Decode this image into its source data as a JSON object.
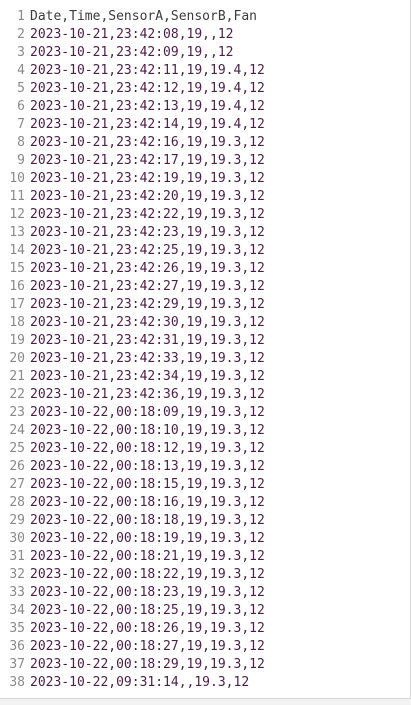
{
  "editor": {
    "lines": [
      {
        "num": "1",
        "text": "Date,Time,SensorA,SensorB,Fan"
      },
      {
        "num": "2",
        "text": "2023-10-21,23:42:08,19,,12"
      },
      {
        "num": "3",
        "text": "2023-10-21,23:42:09,19,,12"
      },
      {
        "num": "4",
        "text": "2023-10-21,23:42:11,19,19.4,12"
      },
      {
        "num": "5",
        "text": "2023-10-21,23:42:12,19,19.4,12"
      },
      {
        "num": "6",
        "text": "2023-10-21,23:42:13,19,19.4,12"
      },
      {
        "num": "7",
        "text": "2023-10-21,23:42:14,19,19.4,12"
      },
      {
        "num": "8",
        "text": "2023-10-21,23:42:16,19,19.3,12"
      },
      {
        "num": "9",
        "text": "2023-10-21,23:42:17,19,19.3,12"
      },
      {
        "num": "10",
        "text": "2023-10-21,23:42:19,19,19.3,12"
      },
      {
        "num": "11",
        "text": "2023-10-21,23:42:20,19,19.3,12"
      },
      {
        "num": "12",
        "text": "2023-10-21,23:42:22,19,19.3,12"
      },
      {
        "num": "13",
        "text": "2023-10-21,23:42:23,19,19.3,12"
      },
      {
        "num": "14",
        "text": "2023-10-21,23:42:25,19,19.3,12"
      },
      {
        "num": "15",
        "text": "2023-10-21,23:42:26,19,19.3,12"
      },
      {
        "num": "16",
        "text": "2023-10-21,23:42:27,19,19.3,12"
      },
      {
        "num": "17",
        "text": "2023-10-21,23:42:29,19,19.3,12"
      },
      {
        "num": "18",
        "text": "2023-10-21,23:42:30,19,19.3,12"
      },
      {
        "num": "19",
        "text": "2023-10-21,23:42:31,19,19.3,12"
      },
      {
        "num": "20",
        "text": "2023-10-21,23:42:33,19,19.3,12"
      },
      {
        "num": "21",
        "text": "2023-10-21,23:42:34,19,19.3,12"
      },
      {
        "num": "22",
        "text": "2023-10-21,23:42:36,19,19.3,12"
      },
      {
        "num": "23",
        "text": "2023-10-22,00:18:09,19,19.3,12"
      },
      {
        "num": "24",
        "text": "2023-10-22,00:18:10,19,19.3,12"
      },
      {
        "num": "25",
        "text": "2023-10-22,00:18:12,19,19.3,12"
      },
      {
        "num": "26",
        "text": "2023-10-22,00:18:13,19,19.3,12"
      },
      {
        "num": "27",
        "text": "2023-10-22,00:18:15,19,19.3,12"
      },
      {
        "num": "28",
        "text": "2023-10-22,00:18:16,19,19.3,12"
      },
      {
        "num": "29",
        "text": "2023-10-22,00:18:18,19,19.3,12"
      },
      {
        "num": "30",
        "text": "2023-10-22,00:18:19,19,19.3,12"
      },
      {
        "num": "31",
        "text": "2023-10-22,00:18:21,19,19.3,12"
      },
      {
        "num": "32",
        "text": "2023-10-22,00:18:22,19,19.3,12"
      },
      {
        "num": "33",
        "text": "2023-10-22,00:18:23,19,19.3,12"
      },
      {
        "num": "34",
        "text": "2023-10-22,00:18:25,19,19.3,12"
      },
      {
        "num": "35",
        "text": "2023-10-22,00:18:26,19,19.3,12"
      },
      {
        "num": "36",
        "text": "2023-10-22,00:18:27,19,19.3,12"
      },
      {
        "num": "37",
        "text": "2023-10-22,00:18:29,19,19.3,12"
      },
      {
        "num": "38",
        "text": "2023-10-22,09:31:14,,19.3,12"
      }
    ]
  }
}
